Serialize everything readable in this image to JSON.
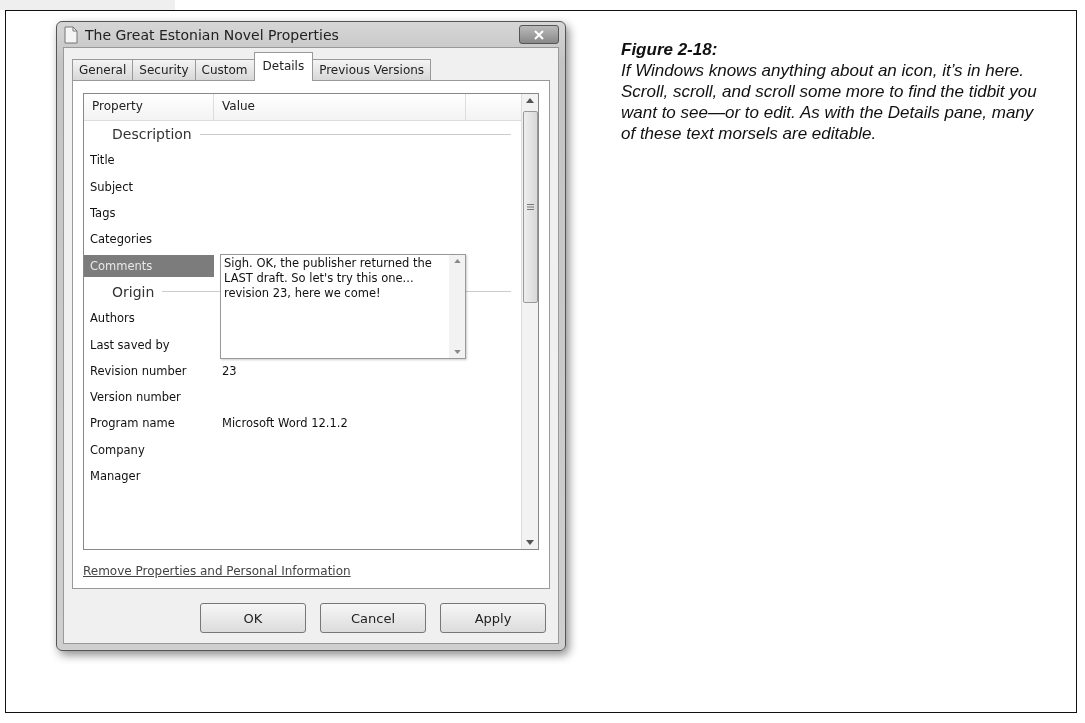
{
  "dialog": {
    "title": "The Great Estonian Novel Properties",
    "tabs": [
      {
        "label": "General",
        "selected": false
      },
      {
        "label": "Security",
        "selected": false
      },
      {
        "label": "Custom",
        "selected": false
      },
      {
        "label": "Details",
        "selected": true
      },
      {
        "label": "Previous Versions",
        "selected": false
      }
    ],
    "columns": [
      "Property",
      "Value"
    ],
    "rows": [
      {
        "kind": "group",
        "label": "Description"
      },
      {
        "kind": "property",
        "label": "Title",
        "value": "",
        "selected": false
      },
      {
        "kind": "property",
        "label": "Subject",
        "value": "",
        "selected": false
      },
      {
        "kind": "property",
        "label": "Tags",
        "value": "",
        "selected": false
      },
      {
        "kind": "property",
        "label": "Categories",
        "value": "",
        "selected": false
      },
      {
        "kind": "property",
        "label": "Comments",
        "value": "Sigh. OK, the publisher returned the LAST draft. So let's try this one... revision 23, here we come!",
        "selected": true
      },
      {
        "kind": "group",
        "label": "Origin"
      },
      {
        "kind": "property",
        "label": "Authors",
        "value": "",
        "selected": false
      },
      {
        "kind": "property",
        "label": "Last saved by",
        "value": "",
        "selected": false
      },
      {
        "kind": "property",
        "label": "Revision number",
        "value": "23",
        "selected": false
      },
      {
        "kind": "property",
        "label": "Version number",
        "value": "",
        "selected": false
      },
      {
        "kind": "property",
        "label": "Program name",
        "value": "Microsoft Word 12.1.2",
        "selected": false
      },
      {
        "kind": "property",
        "label": "Company",
        "value": "",
        "selected": false
      },
      {
        "kind": "property",
        "label": "Manager",
        "value": "",
        "selected": false
      }
    ],
    "link": "Remove Properties and Personal Information",
    "buttons": [
      {
        "label": "OK",
        "disabled": false
      },
      {
        "label": "Cancel",
        "disabled": false
      },
      {
        "label": "Apply",
        "disabled": false
      }
    ]
  },
  "caption": {
    "figure": "Figure 2-18:",
    "text": "If Windows knows anything about an icon, it’s in here. Scroll, scroll, and scroll some more to find the tidbit you want to see—or to edit. As with the Details pane, many of these text morsels are editable."
  }
}
